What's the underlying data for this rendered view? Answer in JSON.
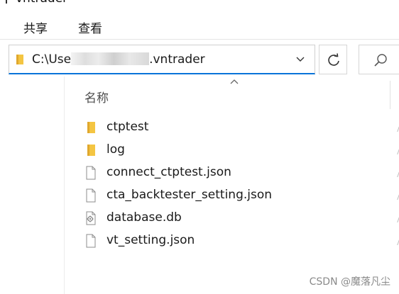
{
  "window": {
    "title": "vntrader"
  },
  "ribbon": {
    "tabs": [
      {
        "label": "共享"
      },
      {
        "label": "查看"
      }
    ]
  },
  "address": {
    "prefix": "C:\\Use",
    "suffix": ".vntrader",
    "icon": "folder-icon"
  },
  "toolbar": {
    "refresh_icon": "refresh-icon",
    "search_icon": "search-icon"
  },
  "file_list": {
    "column_name": "名称",
    "items": [
      {
        "name": "ctptest",
        "type": "folder"
      },
      {
        "name": "log",
        "type": "folder"
      },
      {
        "name": "connect_ctptest.json",
        "type": "file"
      },
      {
        "name": "cta_backtester_setting.json",
        "type": "file"
      },
      {
        "name": "database.db",
        "type": "db"
      },
      {
        "name": "vt_setting.json",
        "type": "file"
      }
    ]
  },
  "watermark": "CSDN @魔落凡尘",
  "colors": {
    "folder": "#f4c542",
    "accent": "#0a74d9"
  }
}
